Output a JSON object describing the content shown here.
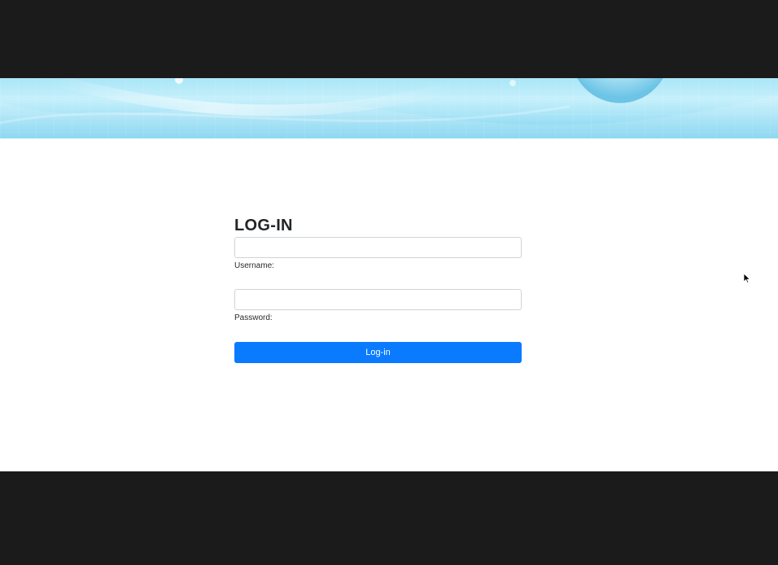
{
  "login": {
    "title": "LOG-IN",
    "username_label": "Username:",
    "username_value": "",
    "password_label": "Password:",
    "password_value": "",
    "submit_label": "Log-in"
  },
  "colors": {
    "button": "#0a7bff",
    "banner": "#a9e6f7",
    "letterbox": "#1b1b1b"
  },
  "icons": {
    "cursor": "mouse-pointer-icon"
  }
}
